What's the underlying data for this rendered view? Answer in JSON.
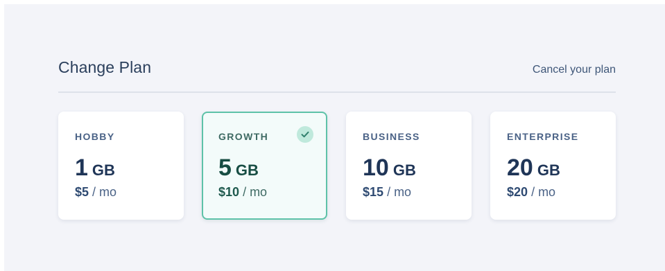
{
  "header": {
    "title": "Change Plan",
    "cancel_label": "Cancel your plan"
  },
  "plans": [
    {
      "name": "HOBBY",
      "size": "1",
      "unit": "GB",
      "price": "$5",
      "period": "/ mo",
      "selected": false
    },
    {
      "name": "GROWTH",
      "size": "5",
      "unit": "GB",
      "price": "$10",
      "period": "/ mo",
      "selected": true
    },
    {
      "name": "BUSINESS",
      "size": "10",
      "unit": "GB",
      "price": "$15",
      "period": "/ mo",
      "selected": false
    },
    {
      "name": "ENTERPRISE",
      "size": "20",
      "unit": "GB",
      "price": "$20",
      "period": "/ mo",
      "selected": false
    }
  ],
  "icons": {
    "selected_indicator": "check-icon"
  },
  "colors": {
    "accent": "#5dc2a8",
    "text_primary": "#1f3557",
    "panel_bg": "#f3f4f9"
  }
}
